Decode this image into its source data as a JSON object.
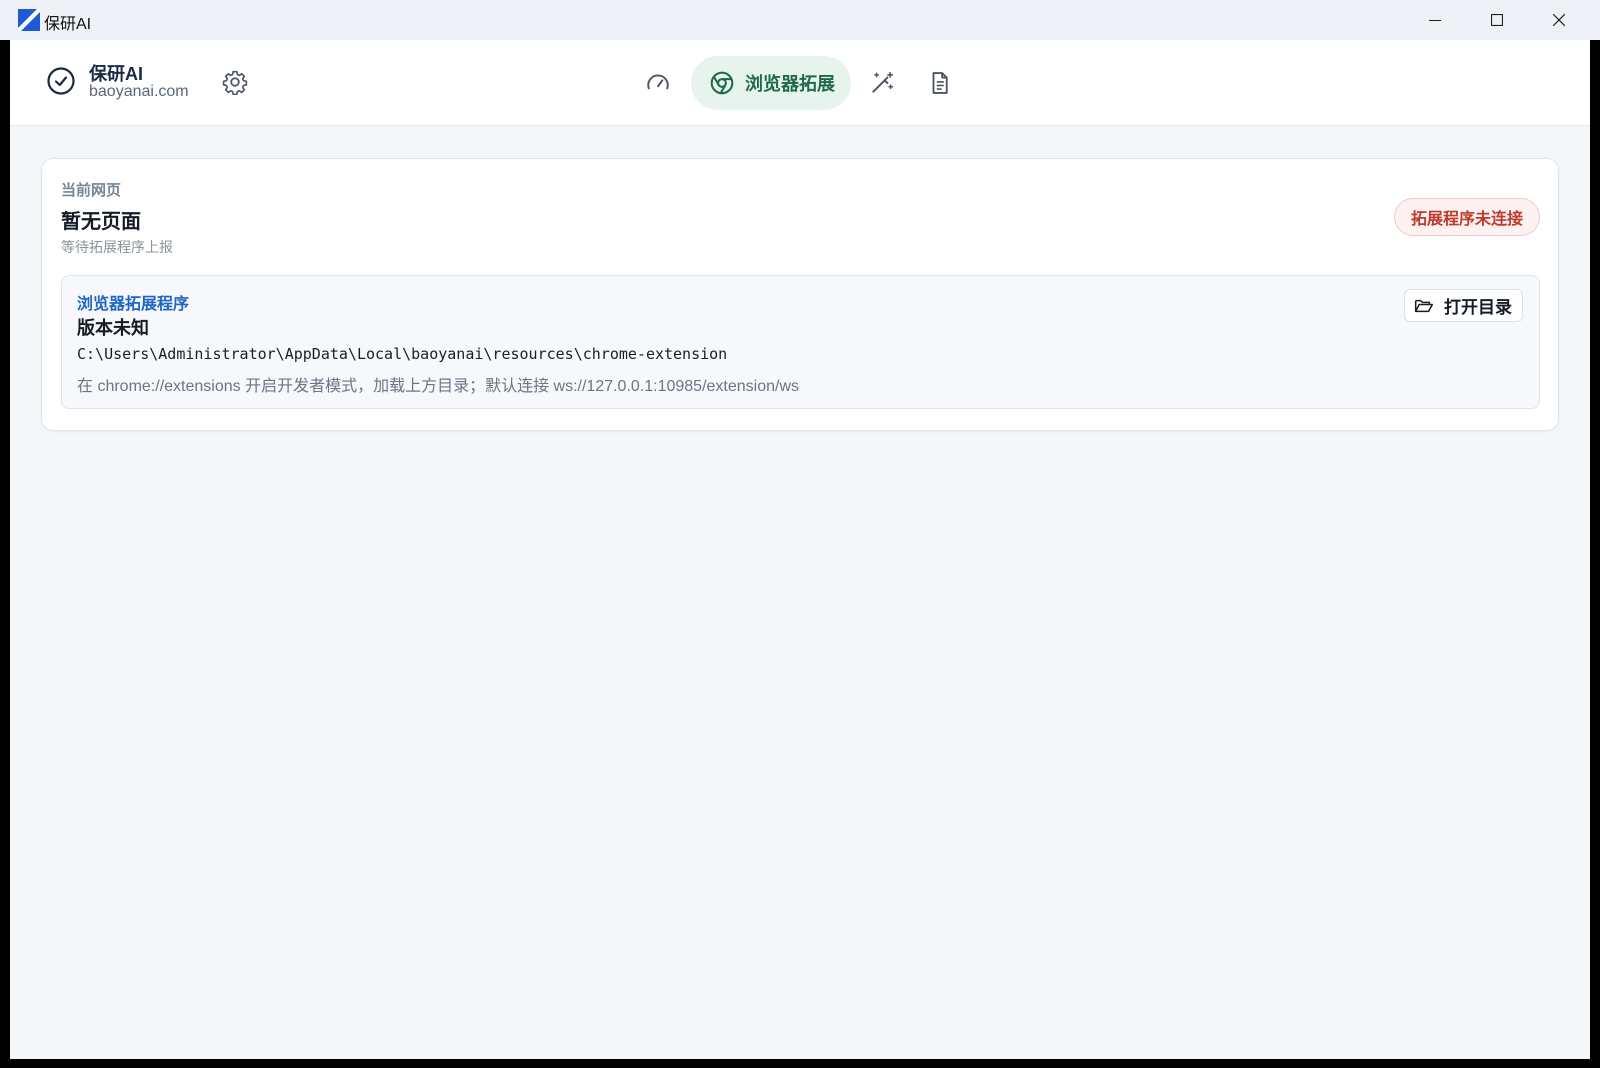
{
  "window": {
    "title": "保研AI",
    "controls": [
      "minimize-icon",
      "maximize-icon",
      "close-icon"
    ]
  },
  "header": {
    "brand_name": "保研AI",
    "brand_domain": "baoyanai.com",
    "nav": [
      {
        "icon": "gauge-icon",
        "label": "",
        "active": false
      },
      {
        "icon": "chrome-icon",
        "label": "浏览器拓展",
        "active": true
      },
      {
        "icon": "magic-wand-icon",
        "label": "",
        "active": false
      },
      {
        "icon": "document-icon",
        "label": "",
        "active": false
      }
    ]
  },
  "current_page": {
    "eyebrow": "当前网页",
    "title": "暂无页面",
    "subtitle": "等待拓展程序上报",
    "status": "拓展程序未连接"
  },
  "extension": {
    "eyebrow": "浏览器拓展程序",
    "version": "版本未知",
    "path": "C:\\Users\\Administrator\\AppData\\Local\\baoyanai\\resources\\chrome-extension",
    "hint": "在 chrome://extensions 开启开发者模式，加载上方目录；默认连接 ws://127.0.0.1:10985/extension/ws",
    "open_button": "打开目录"
  },
  "colors": {
    "accent_green": "#1f6a47",
    "accent_blue": "#1f66c1",
    "status_red": "#c0392b"
  }
}
